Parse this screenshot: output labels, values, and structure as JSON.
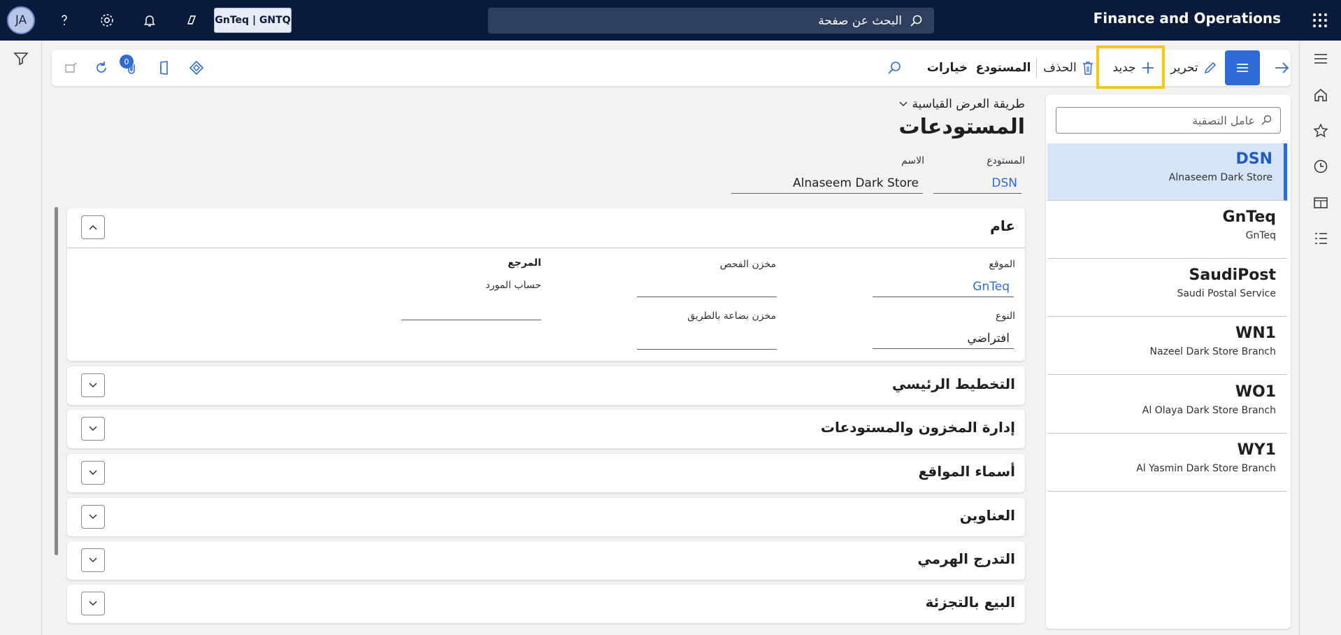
{
  "topbar": {
    "avatar_initials": "JA",
    "company": "GnTeq | GNTQ",
    "search_placeholder": "البحث عن صفحة",
    "app_title": "Finance and Operations"
  },
  "action_pane": {
    "new_label": "جديد",
    "edit_label": "تحرير",
    "delete_label": "الحذف",
    "warehouse_label": "المستودع",
    "options_label": "خيارات",
    "attachments_count": "0"
  },
  "list": {
    "filter_placeholder": "عامل التصفية",
    "items": [
      {
        "id": "DSN",
        "name": "Alnaseem Dark Store",
        "selected": true
      },
      {
        "id": "GnTeq",
        "name": "GnTeq",
        "selected": false
      },
      {
        "id": "SaudiPost",
        "name": "Saudi Postal Service",
        "selected": false
      },
      {
        "id": "WN1",
        "name": "Nazeel Dark Store Branch",
        "selected": false
      },
      {
        "id": "WO1",
        "name": "Al Olaya Dark Store Branch",
        "selected": false
      },
      {
        "id": "WY1",
        "name": "Al Yasmin Dark Store Branch",
        "selected": false
      }
    ]
  },
  "header": {
    "view": "طريقة العرض القياسية",
    "title": "المستودعات",
    "warehouse_label": "المستودع",
    "warehouse_value": "DSN",
    "name_label": "الاسم",
    "name_value": "Alnaseem Dark Store"
  },
  "general": {
    "title": "عام",
    "site_label": "الموقع",
    "site_value": "GnTeq",
    "type_label": "النوع",
    "type_value": "افتراضي",
    "quarantine_label": "مخزن الفحص",
    "transit_label": "مخزن بضاعة بالطريق",
    "reference_label": "المرجع",
    "vendor_account_label": "حساب المورد"
  },
  "fasttabs": [
    {
      "title": "التخطيط الرئيسي"
    },
    {
      "title": "إدارة المخزون والمستودعات"
    },
    {
      "title": "أسماء المواقع"
    },
    {
      "title": "العناوين"
    },
    {
      "title": "التدرج الهرمي"
    },
    {
      "title": "البيع بالتجزئة"
    }
  ],
  "colors": {
    "topbar": "#0a1a3a",
    "accent": "#2f6bd6",
    "highlight": "#f5c518",
    "selected_row": "#d6e4f9"
  }
}
